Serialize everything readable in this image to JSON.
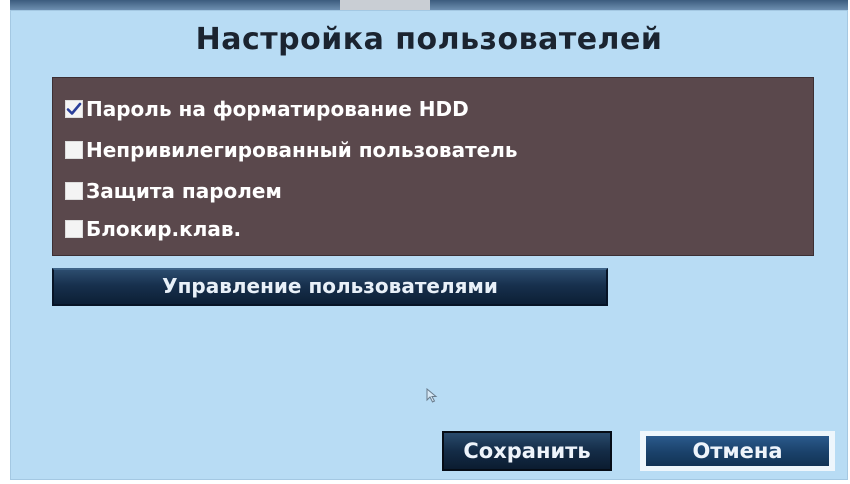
{
  "dialog": {
    "title": "Настройка пользователей"
  },
  "options": [
    {
      "label": "Пароль на форматирование HDD",
      "checked": true
    },
    {
      "label": "Непривилегированный пользователь",
      "checked": false
    },
    {
      "label": "Защита паролем",
      "checked": false
    },
    {
      "label": "Блокир.клав.",
      "checked": false
    }
  ],
  "buttons": {
    "manage_users": "Управление пользователями",
    "save": "Сохранить",
    "cancel": "Отмена"
  },
  "icons": {
    "checkmark": "checkmark-icon",
    "cursor": "mouse-cursor-icon"
  },
  "colors": {
    "dialog_background": "#b8dcf4",
    "panel_background": "#5a484c",
    "button_dark": "#17304d",
    "checkmark": "#2a3f9a"
  }
}
